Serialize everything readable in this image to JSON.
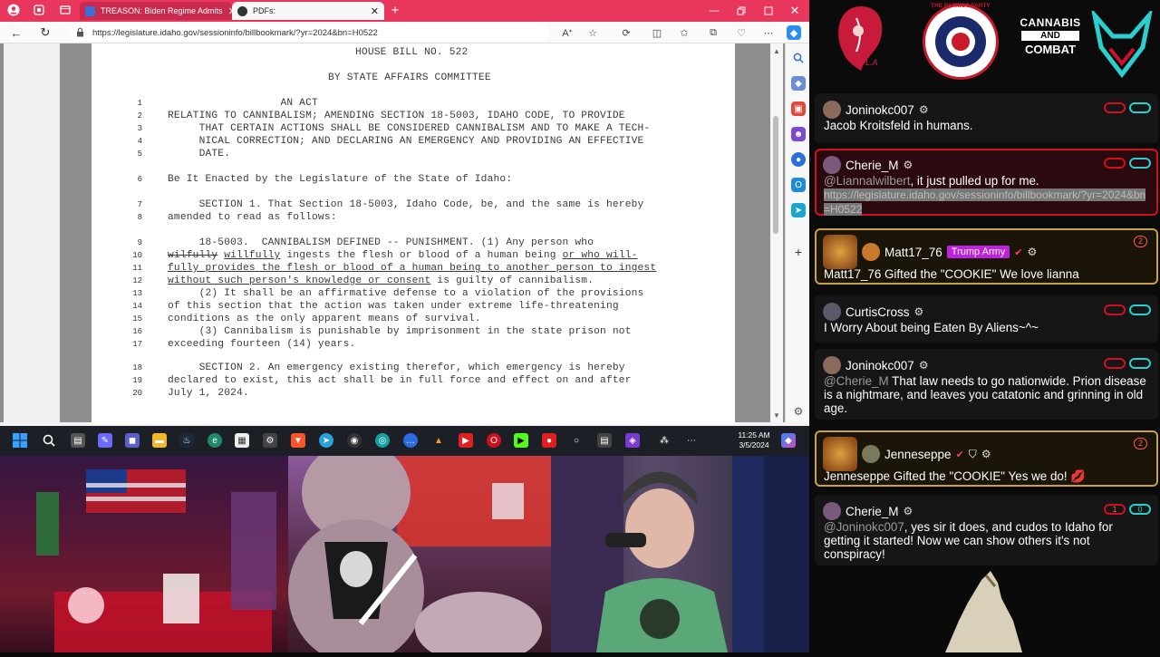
{
  "browser": {
    "tabs": [
      {
        "label": "TREASON: Biden Regime Admits"
      },
      {
        "label": "PDFs:"
      }
    ],
    "url": "https://legislature.idaho.gov/sessioninfo/billbookmark/?yr=2024&bn=H0522"
  },
  "document": {
    "header": "HOUSE BILL NO. 522",
    "committee": "BY STATE AFFAIRS COMMITTEE",
    "lines": [
      {
        "n": "1",
        "segs": [
          {
            "t": "                  AN ACT"
          }
        ]
      },
      {
        "n": "2",
        "segs": [
          {
            "t": "RELATING TO CANNIBALISM; AMENDING SECTION 18-5003, IDAHO CODE, TO PROVIDE"
          }
        ]
      },
      {
        "n": "3",
        "segs": [
          {
            "t": "     THAT CERTAIN ACTIONS SHALL BE CONSIDERED CANNIBALISM AND TO MAKE A TECH-"
          }
        ]
      },
      {
        "n": "4",
        "segs": [
          {
            "t": "     NICAL CORRECTION; AND DECLARING AN EMERGENCY AND PROVIDING AN EFFECTIVE"
          }
        ]
      },
      {
        "n": "5",
        "segs": [
          {
            "t": "     DATE."
          }
        ]
      },
      {
        "n": "6",
        "segs": [
          {
            "t": "Be It Enacted by the Legislature of the State of Idaho:"
          }
        ]
      },
      {
        "n": "7",
        "segs": [
          {
            "t": "     SECTION 1. That Section 18-5003, Idaho Code, be, and the same is hereby"
          }
        ]
      },
      {
        "n": "8",
        "segs": [
          {
            "t": "amended to read as follows:"
          }
        ]
      },
      {
        "n": "9",
        "segs": [
          {
            "t": "     18-5003.  CANNIBALISM DEFINED -- PUNISHMENT. (1) Any person who"
          }
        ]
      },
      {
        "n": "10",
        "segs": [
          {
            "t": "wilfully",
            "c": "s"
          },
          {
            "t": " "
          },
          {
            "t": "willfully",
            "c": "u"
          },
          {
            "t": " ingests the flesh or blood of a human being "
          },
          {
            "t": "or who will-",
            "c": "u"
          }
        ]
      },
      {
        "n": "11",
        "segs": [
          {
            "t": "fully provides the flesh or blood of a human being to another person to ingest",
            "c": "u"
          }
        ]
      },
      {
        "n": "12",
        "segs": [
          {
            "t": "without such person's knowledge or consent",
            "c": "u"
          },
          {
            "t": " is guilty of cannibalism."
          }
        ]
      },
      {
        "n": "13",
        "segs": [
          {
            "t": "     (2) It shall be an affirmative defense to a violation of the provisions"
          }
        ]
      },
      {
        "n": "14",
        "segs": [
          {
            "t": "of this section that the action was taken under extreme life-threatening"
          }
        ]
      },
      {
        "n": "15",
        "segs": [
          {
            "t": "conditions as the only apparent means of survival."
          }
        ]
      },
      {
        "n": "16",
        "segs": [
          {
            "t": "     (3) Cannibalism is punishable by imprisonment in the state prison not"
          }
        ]
      },
      {
        "n": "17",
        "segs": [
          {
            "t": "exceeding fourteen (14) years."
          }
        ]
      },
      {
        "n": "18",
        "segs": [
          {
            "t": "     SECTION 2. An emergency existing therefor, which emergency is hereby"
          }
        ]
      },
      {
        "n": "19",
        "segs": [
          {
            "t": "declared to exist, this act shall be in full force and effect on and after"
          }
        ]
      },
      {
        "n": "20",
        "segs": [
          {
            "t": "July 1, 2024."
          }
        ]
      }
    ]
  },
  "taskbar": {
    "time": "11:25 AM",
    "date": "3/5/2024"
  },
  "logos": {
    "patriot_text": "THE PATRIOT PARTY",
    "cannabis_line1": "CANNABIS",
    "cannabis_line2": "AND",
    "cannabis_line3": "COMBAT",
    "lia_initials": "L.A"
  },
  "chat": [
    {
      "user": "Joninokc007",
      "text": "Jacob Kroitsfeld in humans."
    },
    {
      "user": "Cherie_M",
      "mention": "@Liannalwilbert",
      "text": ", it just pulled up for me.",
      "link": "https://legislature.idaho.gov/sessioninfo/billbookmark/?yr=2024&bn=H0522"
    },
    {
      "user": "Matt17_76",
      "tag": "Trump Army",
      "count": "2",
      "text": "Matt17_76 Gifted the \"COOKIE\" We love lianna"
    },
    {
      "user": "CurtisCross",
      "text": "I Worry About being Eaten By Aliens~^~"
    },
    {
      "user": "Joninokc007",
      "mention": "@Cherie_M",
      "text": " That law needs to go nationwide. Prion disease is a nightmare, and leaves you catatonic and grinning in old age."
    },
    {
      "user": "Jenneseppe",
      "count": "2",
      "text": "Jenneseppe Gifted the \"COOKIE\" Yes we do! 💋"
    },
    {
      "user": "Cherie_M",
      "mention": "@Joninokc007",
      "text": ", yes sir it does, and cudos to Idaho for getting it started! Now we can show others it's not conspiracy!",
      "count_a": "1",
      "count_b": "0"
    }
  ],
  "colors": {
    "tabbar": "#e8365c",
    "highlight_border": "#d0101e",
    "gift_border": "#c8a24a",
    "trump_army_tag": "#c020e0"
  }
}
